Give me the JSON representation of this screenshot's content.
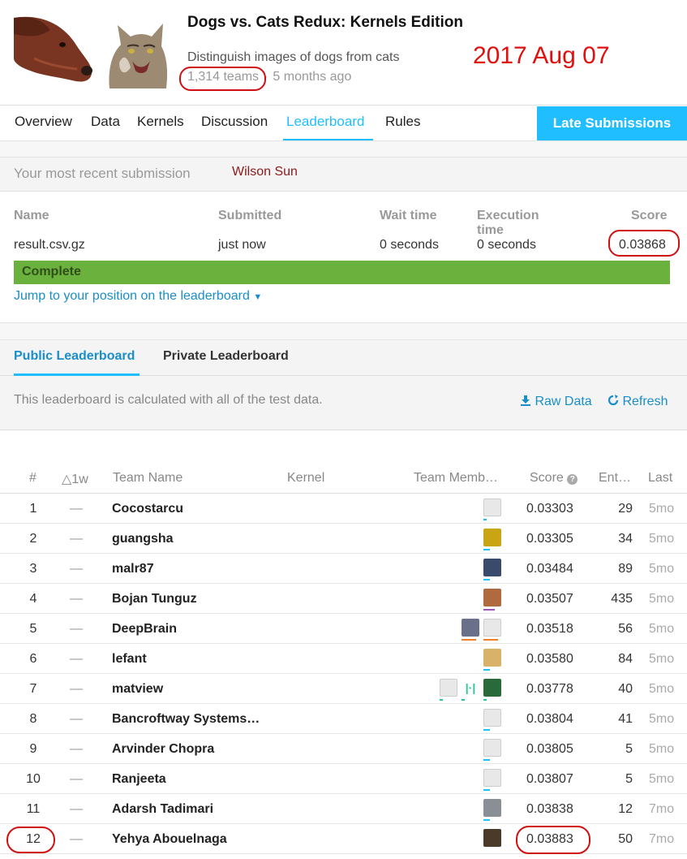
{
  "competition": {
    "title": "Dogs vs. Cats Redux: Kernels Edition",
    "subtitle": "Distinguish images of dogs from cats",
    "teams": "1,314 teams",
    "age": "5 months ago"
  },
  "annotation": {
    "date": "2017 Aug 07",
    "color": "#e01010"
  },
  "tabs": [
    "Overview",
    "Data",
    "Kernels",
    "Discussion",
    "Leaderboard",
    "Rules"
  ],
  "late_button": "Late Submissions",
  "recent": {
    "label": "Your most recent submission",
    "user": "Wilson Sun",
    "headers": {
      "name": "Name",
      "submitted": "Submitted",
      "wait": "Wait time",
      "exec": "Execution time",
      "score": "Score"
    },
    "values": {
      "name": "result.csv.gz",
      "submitted": "just now",
      "wait": "0 seconds",
      "exec": "0 seconds",
      "score": "0.03868"
    },
    "status": "Complete",
    "status_progress": 1.0,
    "jump_link": "Jump to your position on the leaderboard"
  },
  "leaderboard": {
    "tabs": [
      "Public Leaderboard",
      "Private Leaderboard"
    ],
    "info": "This leaderboard is calculated with all of the test data.",
    "raw_data": "Raw Data",
    "refresh": "Refresh",
    "columns": [
      "#",
      "△1w",
      "Team Name",
      "Kernel",
      "Team Memb…",
      "Score",
      "Ent…",
      "Last"
    ],
    "rows": [
      {
        "rank": "1",
        "change": "—",
        "team": "Cocostarcu",
        "score": "0.03303",
        "entries": "29",
        "last": "5mo"
      },
      {
        "rank": "2",
        "change": "—",
        "team": "guangsha",
        "score": "0.03305",
        "entries": "34",
        "last": "5mo"
      },
      {
        "rank": "3",
        "change": "—",
        "team": "malr87",
        "score": "0.03484",
        "entries": "89",
        "last": "5mo"
      },
      {
        "rank": "4",
        "change": "—",
        "team": "Bojan Tunguz",
        "score": "0.03507",
        "entries": "435",
        "last": "5mo"
      },
      {
        "rank": "5",
        "change": "—",
        "team": "DeepBrain",
        "score": "0.03518",
        "entries": "56",
        "last": "5mo"
      },
      {
        "rank": "6",
        "change": "—",
        "team": "lefant",
        "score": "0.03580",
        "entries": "84",
        "last": "5mo"
      },
      {
        "rank": "7",
        "change": "—",
        "team": "matview",
        "score": "0.03778",
        "entries": "40",
        "last": "5mo"
      },
      {
        "rank": "8",
        "change": "—",
        "team": "Bancroftway Systems…",
        "score": "0.03804",
        "entries": "41",
        "last": "5mo"
      },
      {
        "rank": "9",
        "change": "—",
        "team": "Arvinder Chopra",
        "score": "0.03805",
        "entries": "5",
        "last": "5mo"
      },
      {
        "rank": "10",
        "change": "—",
        "team": "Ranjeeta",
        "score": "0.03807",
        "entries": "5",
        "last": "5mo"
      },
      {
        "rank": "11",
        "change": "—",
        "team": "Adarsh Tadimari",
        "score": "0.03838",
        "entries": "12",
        "last": "7mo"
      },
      {
        "rank": "12",
        "change": "—",
        "team": "Yehya Abouelnaga",
        "score": "0.03883",
        "entries": "50",
        "last": "7mo"
      }
    ]
  },
  "colors": {
    "accent": "#20beff",
    "link": "#1a8ec9",
    "complete": "#6bb13d",
    "highlight": "#d01010"
  }
}
